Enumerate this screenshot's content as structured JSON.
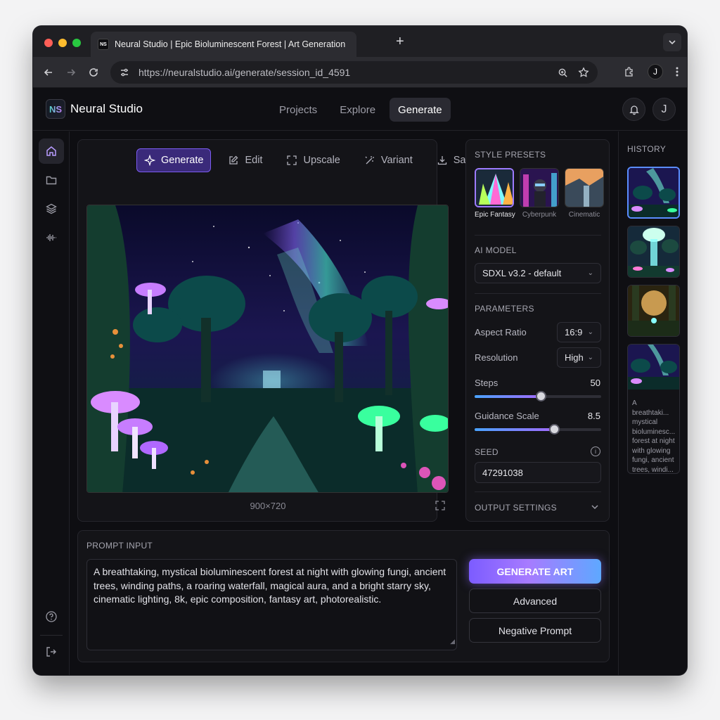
{
  "browser": {
    "tab_title": "Neural Studio | Epic Bioluminescent Forest | Art Generation",
    "tab_favicon": "NS",
    "url": "https://neuralstudio.ai/generate/session_id_4591",
    "profile_initial": "J"
  },
  "header": {
    "logo": "NS",
    "brand": "Neural Studio",
    "nav": [
      "Projects",
      "Explore",
      "Generate"
    ],
    "active_nav": "Generate",
    "avatar_initial": "J"
  },
  "rail": {
    "icons": [
      "home-icon",
      "folder-icon",
      "layers-icon",
      "waveform-icon",
      "help-icon",
      "logout-icon"
    ]
  },
  "toolbar": {
    "generate": "Generate",
    "edit": "Edit",
    "upscale": "Upscale",
    "variant": "Variant",
    "save": "Save"
  },
  "canvas": {
    "dimensions": "900×720"
  },
  "settings": {
    "style_presets_label": "STYLE PRESETS",
    "presets": [
      "Epic Fantasy",
      "Cyberpunk",
      "Cinematic"
    ],
    "selected_preset": "Epic Fantasy",
    "ai_model_label": "AI MODEL",
    "ai_model": "SDXL v3.2 - default",
    "parameters_label": "PARAMETERS",
    "aspect_ratio_label": "Aspect Ratio",
    "aspect_ratio": "16:9",
    "resolution_label": "Resolution",
    "resolution": "High",
    "steps_label": "Steps",
    "steps": "50",
    "steps_fraction": 0.52,
    "guidance_label": "Guidance Scale",
    "guidance": "8.5",
    "guidance_fraction": 0.63,
    "seed_label": "SEED",
    "seed": "47291038",
    "output_label": "OUTPUT SETTINGS"
  },
  "history": {
    "label": "HISTORY",
    "card_text": "A breathtaki... mystical bioluminesc... forest at night with glowing fungi, ancient trees, windi... paths, a roa..."
  },
  "prompt": {
    "label": "PROMPT INPUT",
    "text": "A breathtaking, mystical bioluminescent forest at night with glowing fungi, ancient trees, winding paths, a roaring waterfall, magical aura, and a bright starry sky, cinematic lighting, 8k, epic composition, fantasy art, photorealistic.",
    "generate_button": "GENERATE ART",
    "advanced_button": "Advanced",
    "negative_button": "Negative Prompt"
  },
  "colors": {
    "accent": "#8b6cff",
    "background": "#0e0e12",
    "panel": "#141418"
  }
}
